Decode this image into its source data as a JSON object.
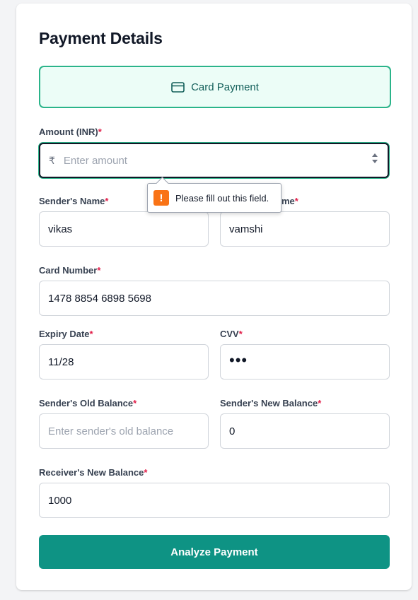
{
  "form": {
    "title": "Payment Details",
    "method_label": "Card Payment",
    "amount": {
      "label": "Amount (INR)",
      "currency_symbol": "₹",
      "placeholder": "Enter amount",
      "value": ""
    },
    "sender_name": {
      "label": "Sender's Name",
      "value": "vikas"
    },
    "receiver_name": {
      "label_visible_part": "me",
      "value": "vamshi"
    },
    "card_number": {
      "label": "Card Number",
      "value": "1478 8854 6898 5698"
    },
    "expiry_date": {
      "label": "Expiry Date",
      "value": "11/28"
    },
    "cvv": {
      "label": "CVV",
      "masked_value": "•••"
    },
    "sender_old_balance": {
      "label": "Sender's Old Balance",
      "placeholder": "Enter sender's old balance",
      "value": ""
    },
    "sender_new_balance": {
      "label": "Sender's New Balance",
      "value": "0"
    },
    "receiver_new_balance": {
      "label": "Receiver's New Balance",
      "value": "1000"
    },
    "required_marker": "*",
    "submit_label": "Analyze Payment"
  },
  "validation_tooltip": {
    "icon": "!",
    "message": "Please fill out this field."
  },
  "colors": {
    "accent": "#0e9384",
    "method_border": "#2bb48a",
    "method_bg": "#ecfdf7",
    "required": "#e11d48",
    "warning": "#f97316"
  },
  "icons": {
    "method": "credit-card-icon",
    "tooltip": "warning-icon"
  }
}
